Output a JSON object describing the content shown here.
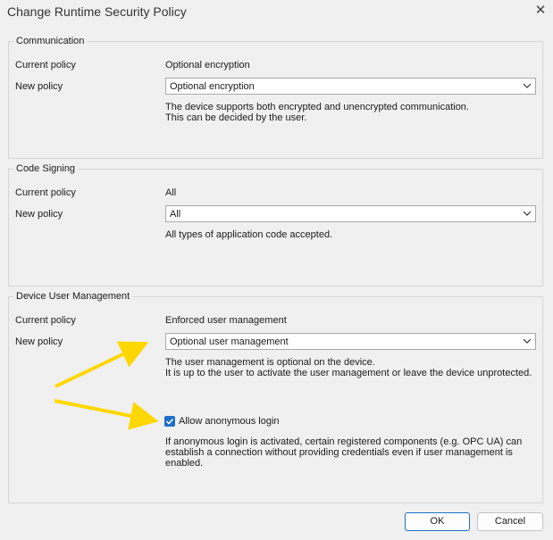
{
  "window": {
    "title": "Change Runtime Security Policy",
    "close_glyph": "✕"
  },
  "communication": {
    "legend": "Communication",
    "current_label": "Current policy",
    "current_value": "Optional encryption",
    "new_label": "New policy",
    "selected": "Optional encryption",
    "description": [
      "The device supports both encrypted and unencrypted communication.",
      "This can be decided by the user."
    ]
  },
  "code_signing": {
    "legend": "Code Signing",
    "current_label": "Current policy",
    "current_value": "All",
    "new_label": "New policy",
    "selected": "All",
    "description": [
      "All types of application code accepted."
    ]
  },
  "device_user_management": {
    "legend": "Device User Management",
    "current_label": "Current policy",
    "current_value": "Enforced user management",
    "new_label": "New policy",
    "selected": "Optional user management",
    "description": [
      "The user management is optional on the device.",
      "It is up to the user to activate the user management or leave the device unprotected."
    ],
    "anonymous_login": {
      "label": "Allow anonymous login",
      "checked": true,
      "description": [
        "If anonymous login is activated, certain registered components (e.g. OPC UA) can",
        "establish a connection without providing credentials even if user management is",
        "enabled."
      ]
    }
  },
  "buttons": {
    "ok": "OK",
    "cancel": "Cancel"
  },
  "colors": {
    "accent": "#1e6fc7",
    "annotation_arrow": "#ffd700"
  }
}
